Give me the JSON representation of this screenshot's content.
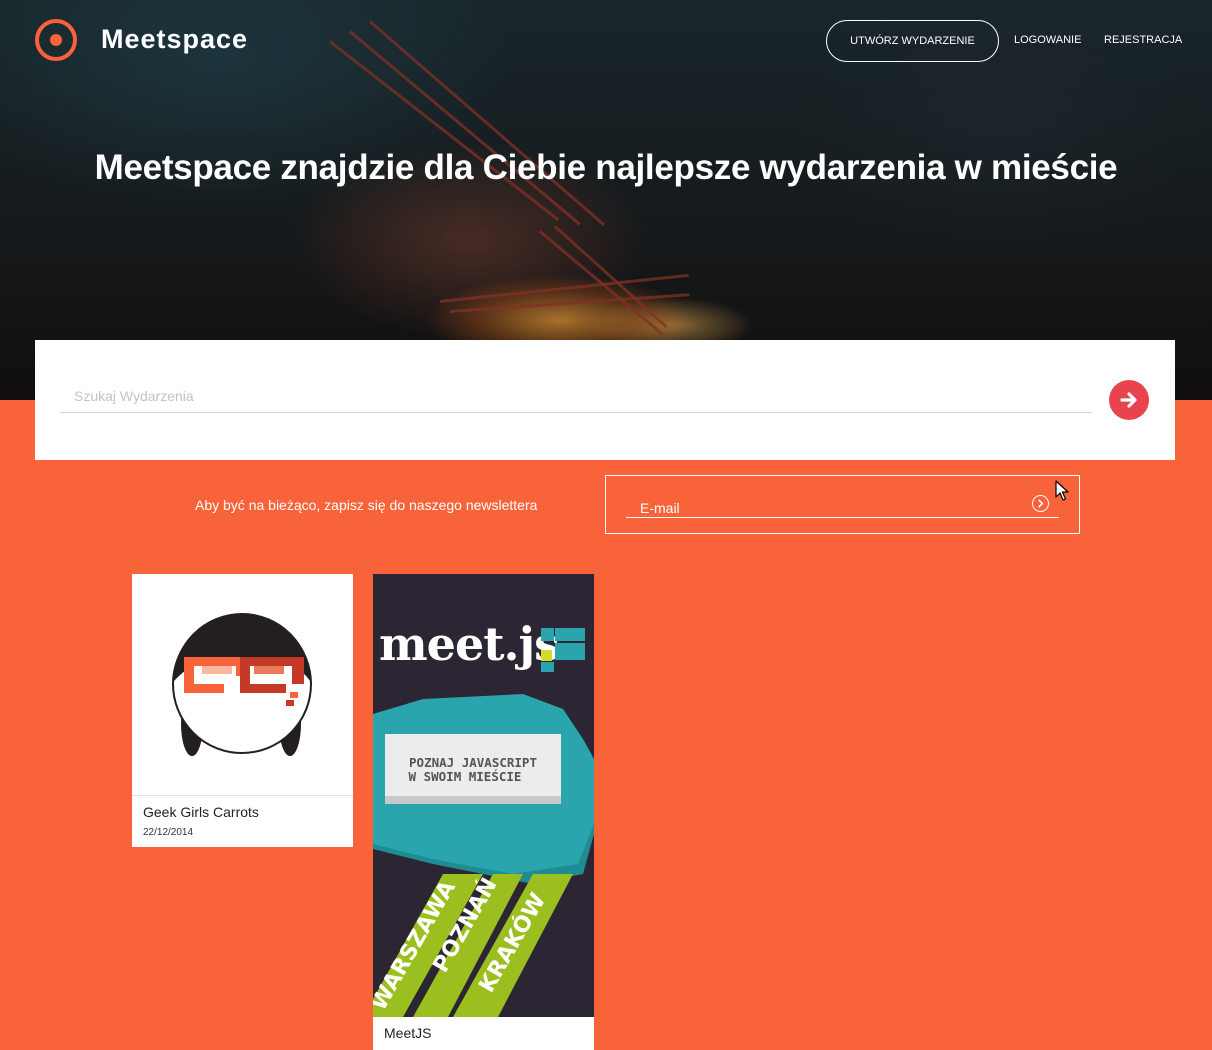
{
  "header": {
    "brand": "Meetspace",
    "create_event_label": "UTWÓRZ WYDARZENIE",
    "login_label": "LOGOWANIE",
    "register_label": "REJESTRACJA"
  },
  "hero": {
    "headline": "Meetspace znajdzie dla Ciebie najlepsze wydarzenia w mieście"
  },
  "search": {
    "placeholder": "Szukaj Wydarzenia",
    "submit_icon": "arrow-right-icon"
  },
  "newsletter": {
    "text": "Aby być na bieżąco, zapisz się do naszego newslettera",
    "email_placeholder": "E-mail",
    "submit_icon": "chevron-right-circle-icon"
  },
  "events": [
    {
      "title": "Geek Girls Carrots",
      "date": "22/12/2014"
    },
    {
      "title": "MeetJS",
      "poster": {
        "logo": "meet.js",
        "tagline_line1": "POZNAJ JAVASCRIPT",
        "tagline_line2": "W SWOIM MIEŚCIE",
        "cities": [
          "WARSZAWA",
          "POZNAŃ",
          "KRAKÓW"
        ]
      }
    }
  ],
  "colors": {
    "accent": "#f8633a",
    "search_button": "#e9444e",
    "meetjs_teal": "#2aa5ad",
    "meetjs_green": "#9bbf1f",
    "meetjs_bg": "#2c2533"
  }
}
